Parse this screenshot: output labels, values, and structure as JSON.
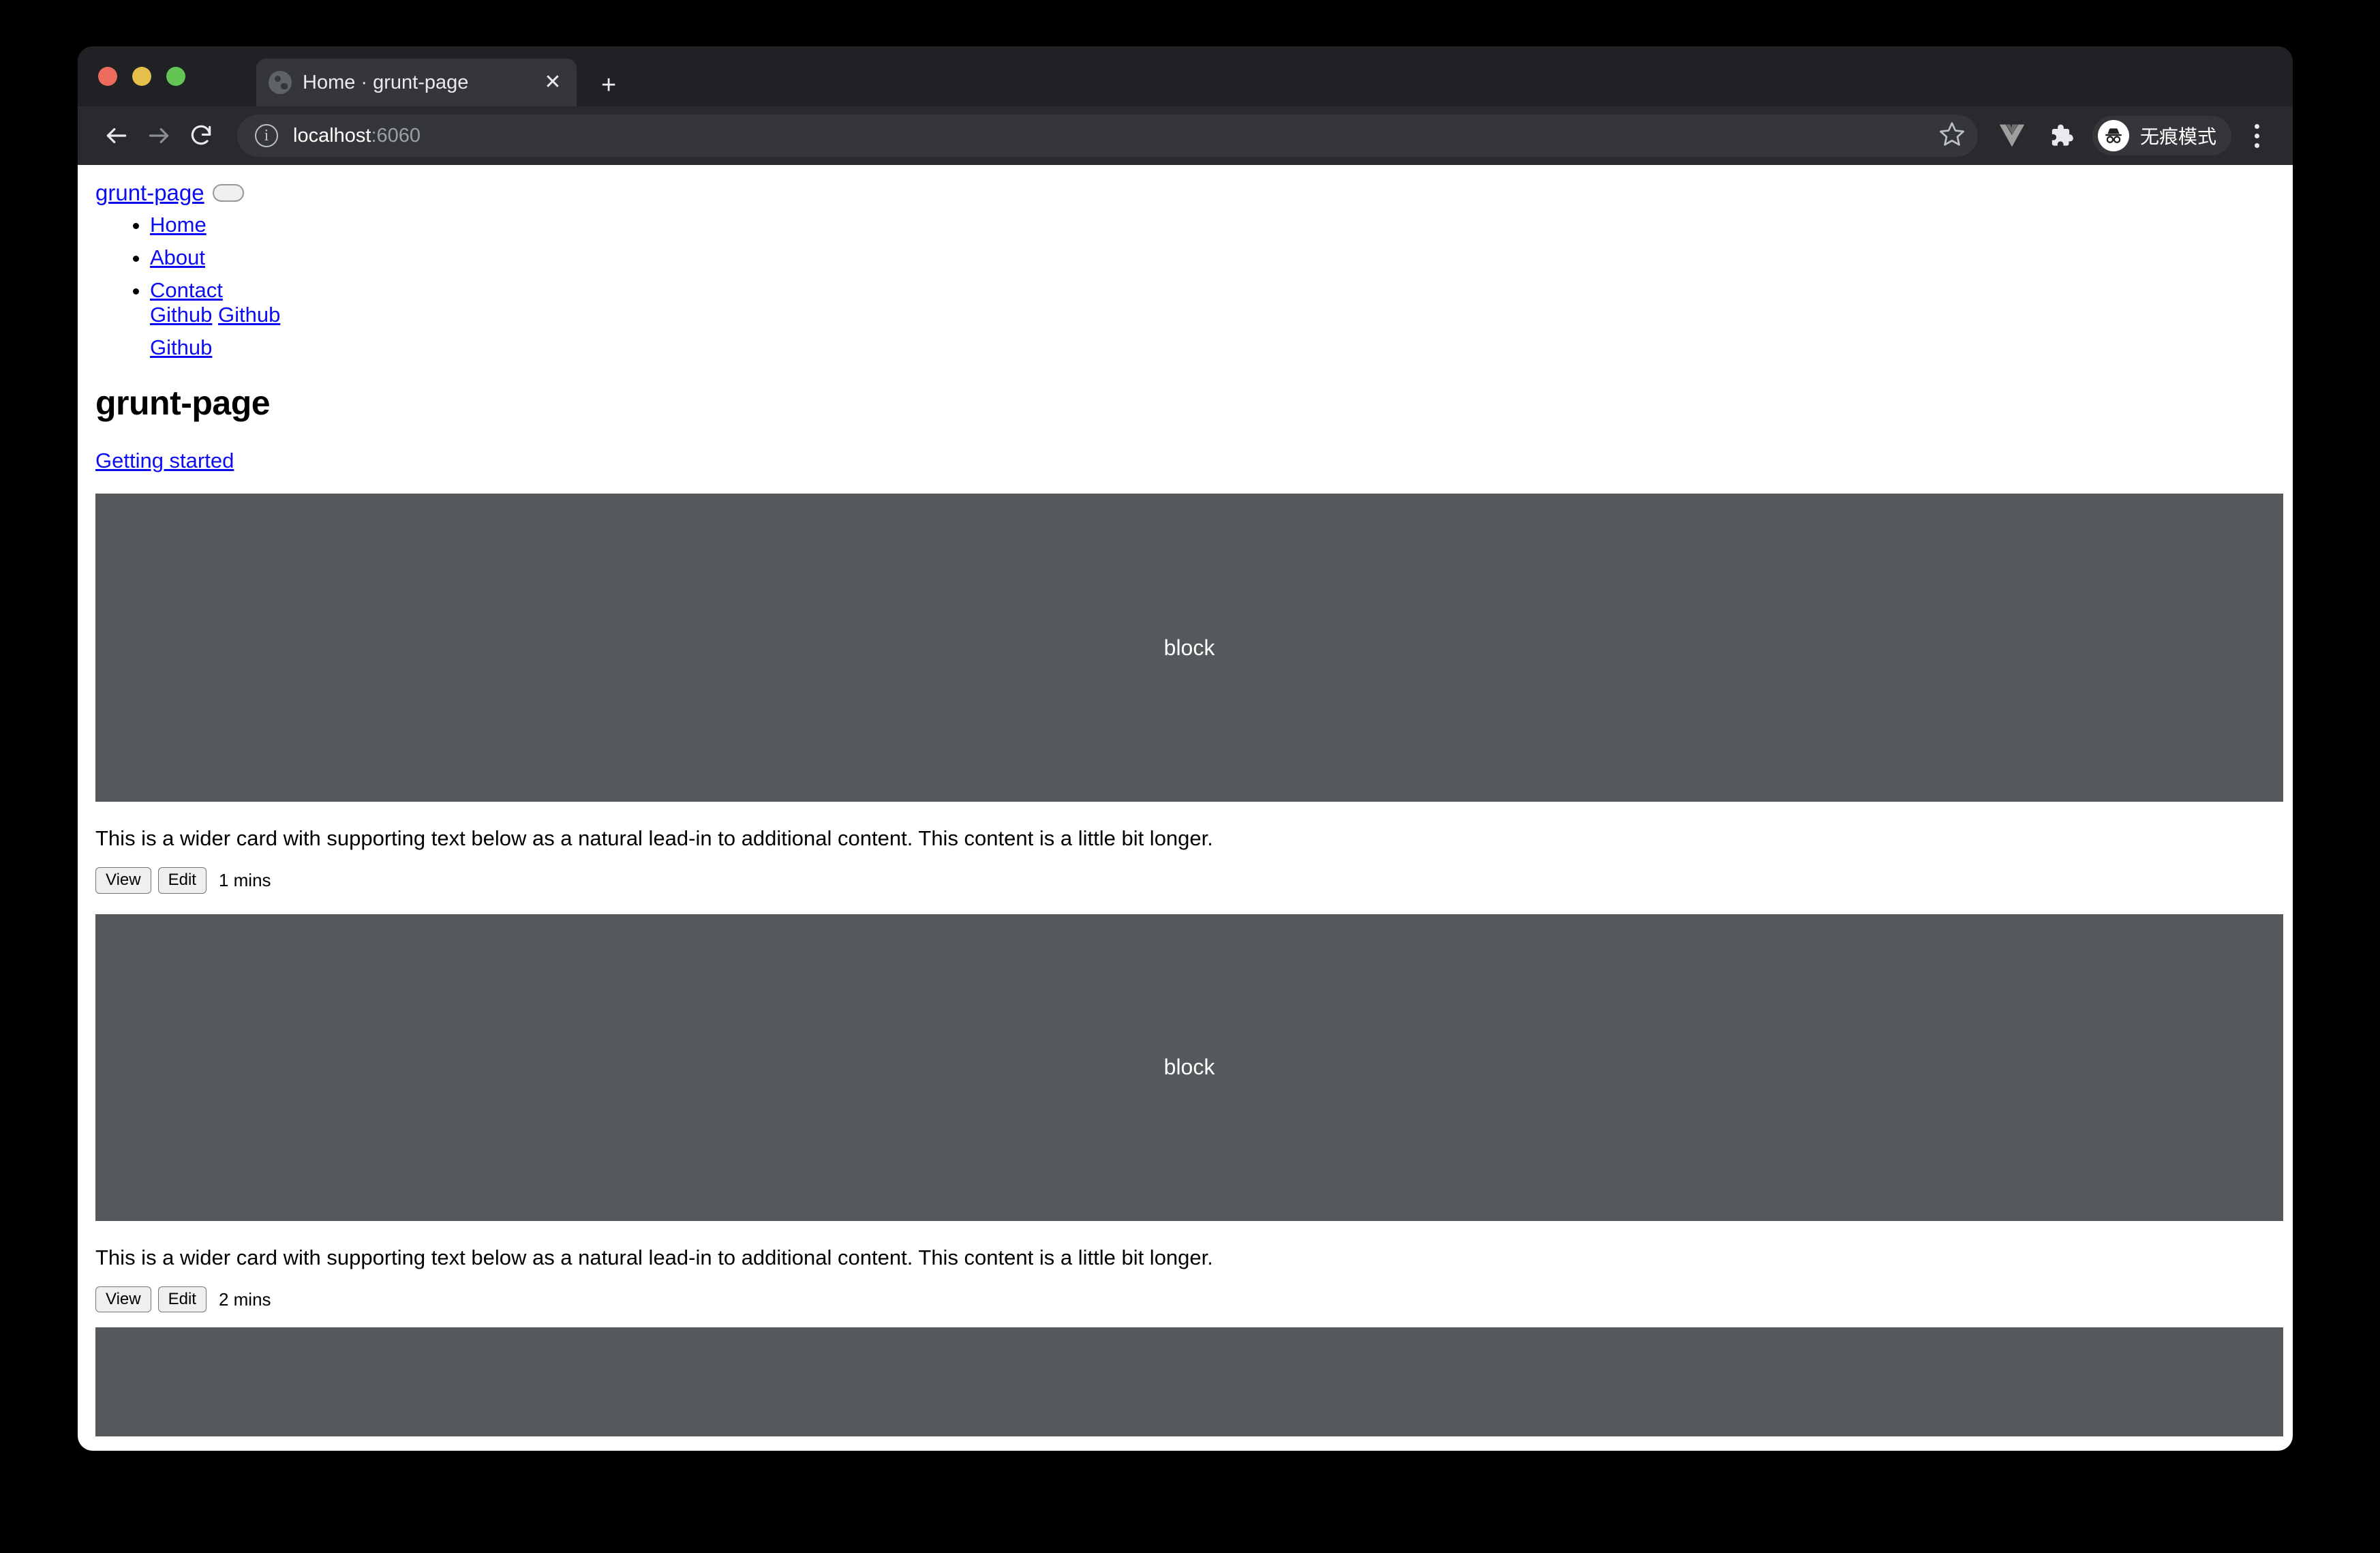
{
  "browser": {
    "tab": {
      "title": "Home · grunt-page",
      "favicon": "globe-icon",
      "close": "✕"
    },
    "new_tab_label": "+",
    "toolbar": {
      "back": "←",
      "forward": "→",
      "reload": "⟳",
      "url_host": "localhost",
      "url_port": ":6060",
      "url_full": "localhost:6060",
      "security_icon": "info-icon",
      "bookmark_icon": "star-icon",
      "vue_devtools_icon": "vue-icon",
      "extensions_icon": "puzzle-icon",
      "incognito_label": "无痕模式",
      "menu_icon": "three-dot-menu-icon"
    },
    "colors": {
      "tabstrip": "#202124",
      "toolbar": "#292a2d",
      "active_tab": "#35363a",
      "text": "#e8eaed"
    }
  },
  "page": {
    "brand": "grunt-page",
    "navbar_toggler": "navbar-toggler",
    "nav_items": [
      {
        "label": "Home"
      },
      {
        "label": "About"
      },
      {
        "label": "Contact"
      }
    ],
    "nav_extra_line1": [
      "Github",
      "Github"
    ],
    "nav_extra_line2": [
      "Github"
    ],
    "title": "grunt-page",
    "getting_started": "Getting started",
    "block_placeholder": "block",
    "cards": [
      {
        "text": "This is a wider card with supporting text below as a natural lead-in to additional content. This content is a little bit longer.",
        "view_label": "View",
        "edit_label": "Edit",
        "time": "1 mins"
      },
      {
        "text": "This is a wider card with supporting text below as a natural lead-in to additional content. This content is a little bit longer.",
        "view_label": "View",
        "edit_label": "Edit",
        "time": "2 mins"
      }
    ],
    "colors": {
      "link": "#0d0df2",
      "placeholder_bg": "#55595c",
      "placeholder_text": "#ffffff"
    }
  }
}
